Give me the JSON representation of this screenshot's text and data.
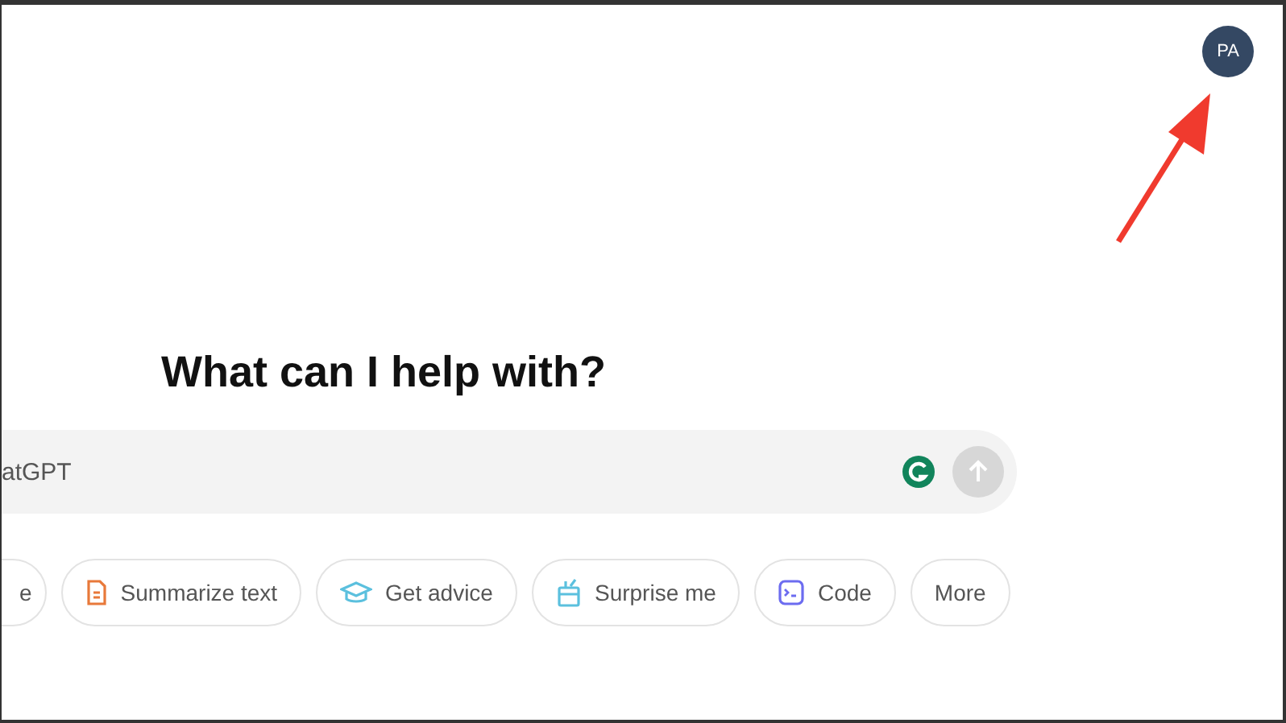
{
  "avatar": {
    "initials": "PA"
  },
  "heading": "What can I help with?",
  "composer": {
    "placeholder": "atGPT",
    "send_disabled": true
  },
  "chips": [
    {
      "label": "e",
      "kind": "plain"
    },
    {
      "label": "Summarize text",
      "kind": "document"
    },
    {
      "label": "Get advice",
      "kind": "cap"
    },
    {
      "label": "Surprise me",
      "kind": "gift"
    },
    {
      "label": "Code",
      "kind": "terminal"
    },
    {
      "label": "More",
      "kind": "plain"
    }
  ]
}
